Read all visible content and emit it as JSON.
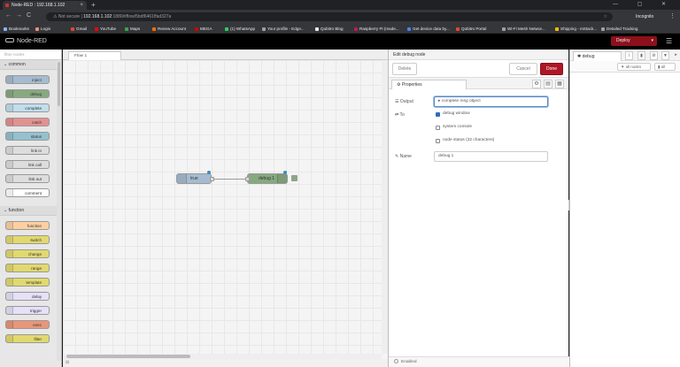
{
  "browser": {
    "tab_title": "Node-RED : 192.168.1.102",
    "close_glyph": "×",
    "new_tab_glyph": "+",
    "window_controls": "—  ▢  ✕",
    "back_glyph": "←",
    "forward_glyph": "→",
    "reload_glyph": "C",
    "security_label": "Not secure",
    "url_host": "192.168.1.102",
    "url_path": ":1880/#flow/5bdf6461ffad327a",
    "star_glyph": "☆",
    "profile_label": "Incognito",
    "menu_glyph": "⋮"
  },
  "bookmarks": [
    {
      "label": "Bookmarks",
      "color": "#8ab4f8"
    },
    {
      "label": "Login",
      "color": "#f28b82"
    },
    {
      "label": "Gmail",
      "color": "#ea4335"
    },
    {
      "label": "YouTube",
      "color": "#ff0000"
    },
    {
      "label": "Maps",
      "color": "#34a853"
    },
    {
      "label": "Renew Account",
      "color": "#ff6d00"
    },
    {
      "label": "MEGA",
      "color": "#d50000"
    },
    {
      "label": "(1) WhatsApp",
      "color": "#25d366"
    },
    {
      "label": "Your profile - Edge...",
      "color": "#9aa0a6"
    },
    {
      "label": "Qubitro Blog",
      "color": "#e8eaed"
    },
    {
      "label": "Raspberry Pi (made...",
      "color": "#c51a4a"
    },
    {
      "label": "Get device data by...",
      "color": "#4285f4"
    },
    {
      "label": "Qubitro Portal",
      "color": "#ea4335"
    },
    {
      "label": "Wi-Fi Mesh Networ...",
      "color": "#9aa0a6"
    },
    {
      "label": "Shipping - mStack...",
      "color": "#fbbc04"
    },
    {
      "label": "Detailed Tracking",
      "color": "#9aa0a6"
    }
  ],
  "app": {
    "name": "Node-RED",
    "deploy_label": "Deploy",
    "deploy_arrow": "▾",
    "menu_glyph": "☰"
  },
  "palette": {
    "filter_placeholder": "filter nodes",
    "categories": [
      {
        "name": "common",
        "nodes": [
          {
            "label": "inject",
            "color": "#a6bbcf"
          },
          {
            "label": "debug",
            "color": "#87a980"
          },
          {
            "label": "complete",
            "color": "#c0deed"
          },
          {
            "label": "catch",
            "color": "#e49191"
          },
          {
            "label": "status",
            "color": "#94c1d0"
          },
          {
            "label": "link in",
            "color": "#dddddd"
          },
          {
            "label": "link call",
            "color": "#dddddd"
          },
          {
            "label": "link out",
            "color": "#dddddd"
          },
          {
            "label": "comment",
            "color": "#ffffff"
          }
        ]
      },
      {
        "name": "function",
        "nodes": [
          {
            "label": "function",
            "color": "#fdd0a2"
          },
          {
            "label": "switch",
            "color": "#e2d96e"
          },
          {
            "label": "change",
            "color": "#e2d96e"
          },
          {
            "label": "range",
            "color": "#e2d96e"
          },
          {
            "label": "template",
            "color": "#e2d96e"
          },
          {
            "label": "delay",
            "color": "#e6e0f8"
          },
          {
            "label": "trigger",
            "color": "#e6e0f8"
          },
          {
            "label": "exec",
            "color": "#e9967a"
          },
          {
            "label": "filter",
            "color": "#e2d96e"
          }
        ]
      }
    ]
  },
  "workspace": {
    "flow_tab": "Flow 1",
    "nodes": [
      {
        "label": "true",
        "color": "#a6bbcf"
      },
      {
        "label": "debug 1",
        "color": "#87a980"
      }
    ]
  },
  "edit_tray": {
    "title": "Edit debug node",
    "delete_label": "Delete",
    "cancel_label": "Cancel",
    "done_label": "Done",
    "properties_tab": "Properties",
    "output_label": "Output",
    "output_value": "complete msg object",
    "to_label": "To",
    "options": [
      {
        "label": "debug window",
        "checked": true
      },
      {
        "label": "system console",
        "checked": false
      },
      {
        "label": "node status (32 characters)",
        "checked": false
      }
    ],
    "name_label": "Name",
    "name_value": "debug 1",
    "enabled_label": "Enabled"
  },
  "sidebar": {
    "tab_label": "debug",
    "filter_label": "all nodes",
    "clear_label": "all"
  }
}
